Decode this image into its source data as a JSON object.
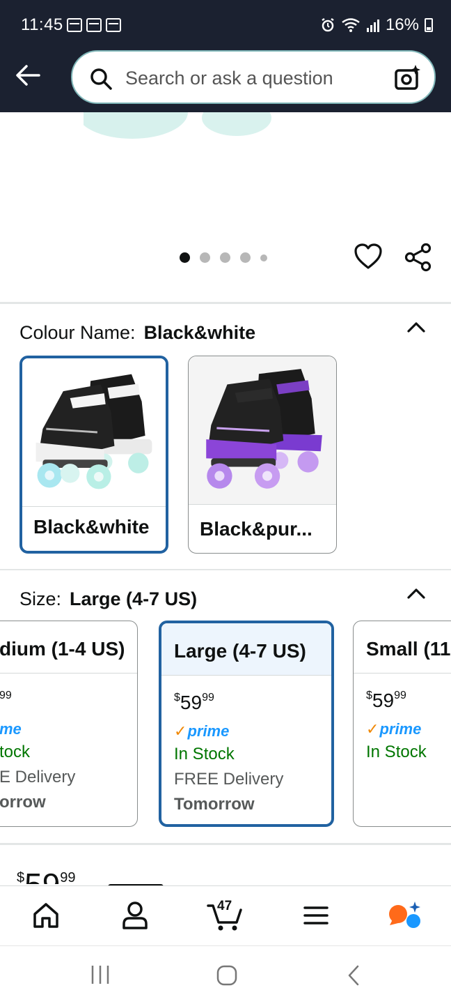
{
  "status_bar": {
    "time": "11:45",
    "battery": "16%"
  },
  "search": {
    "placeholder": "Search or ask a question"
  },
  "carousel": {
    "count": 5,
    "active_index": 0
  },
  "colour": {
    "label": "Colour Name:",
    "selected": "Black&white",
    "options": [
      {
        "name": "Black&white",
        "accent": "#9fe3d6"
      },
      {
        "name": "Black&pur...",
        "accent": "#8a3fd1"
      }
    ]
  },
  "size": {
    "label": "Size:",
    "selected": "Large (4-7 US)",
    "options": [
      {
        "name": "dium (1-4 US)",
        "price_main": "",
        "price_frac": "99",
        "prime": "me",
        "stock": "tock",
        "delivery": "E Delivery",
        "when": "orrow"
      },
      {
        "name": "Large (4-7 US)",
        "price_main": "59",
        "price_frac": "99",
        "prime": "prime",
        "stock": "In Stock",
        "delivery": "FREE Delivery",
        "when": "Tomorrow"
      },
      {
        "name": "Small (11",
        "price_main": "59",
        "price_frac": "99",
        "prime": "prime",
        "stock": "In Stock",
        "delivery": "",
        "when": ""
      }
    ]
  },
  "price_peek": {
    "main": "59",
    "frac": "99"
  },
  "nav": {
    "cart_count": "47"
  },
  "colors": {
    "header_bg": "#1b2130",
    "selected_border": "#2162a1",
    "prime_blue": "#1a98ff",
    "in_stock": "#007600"
  }
}
